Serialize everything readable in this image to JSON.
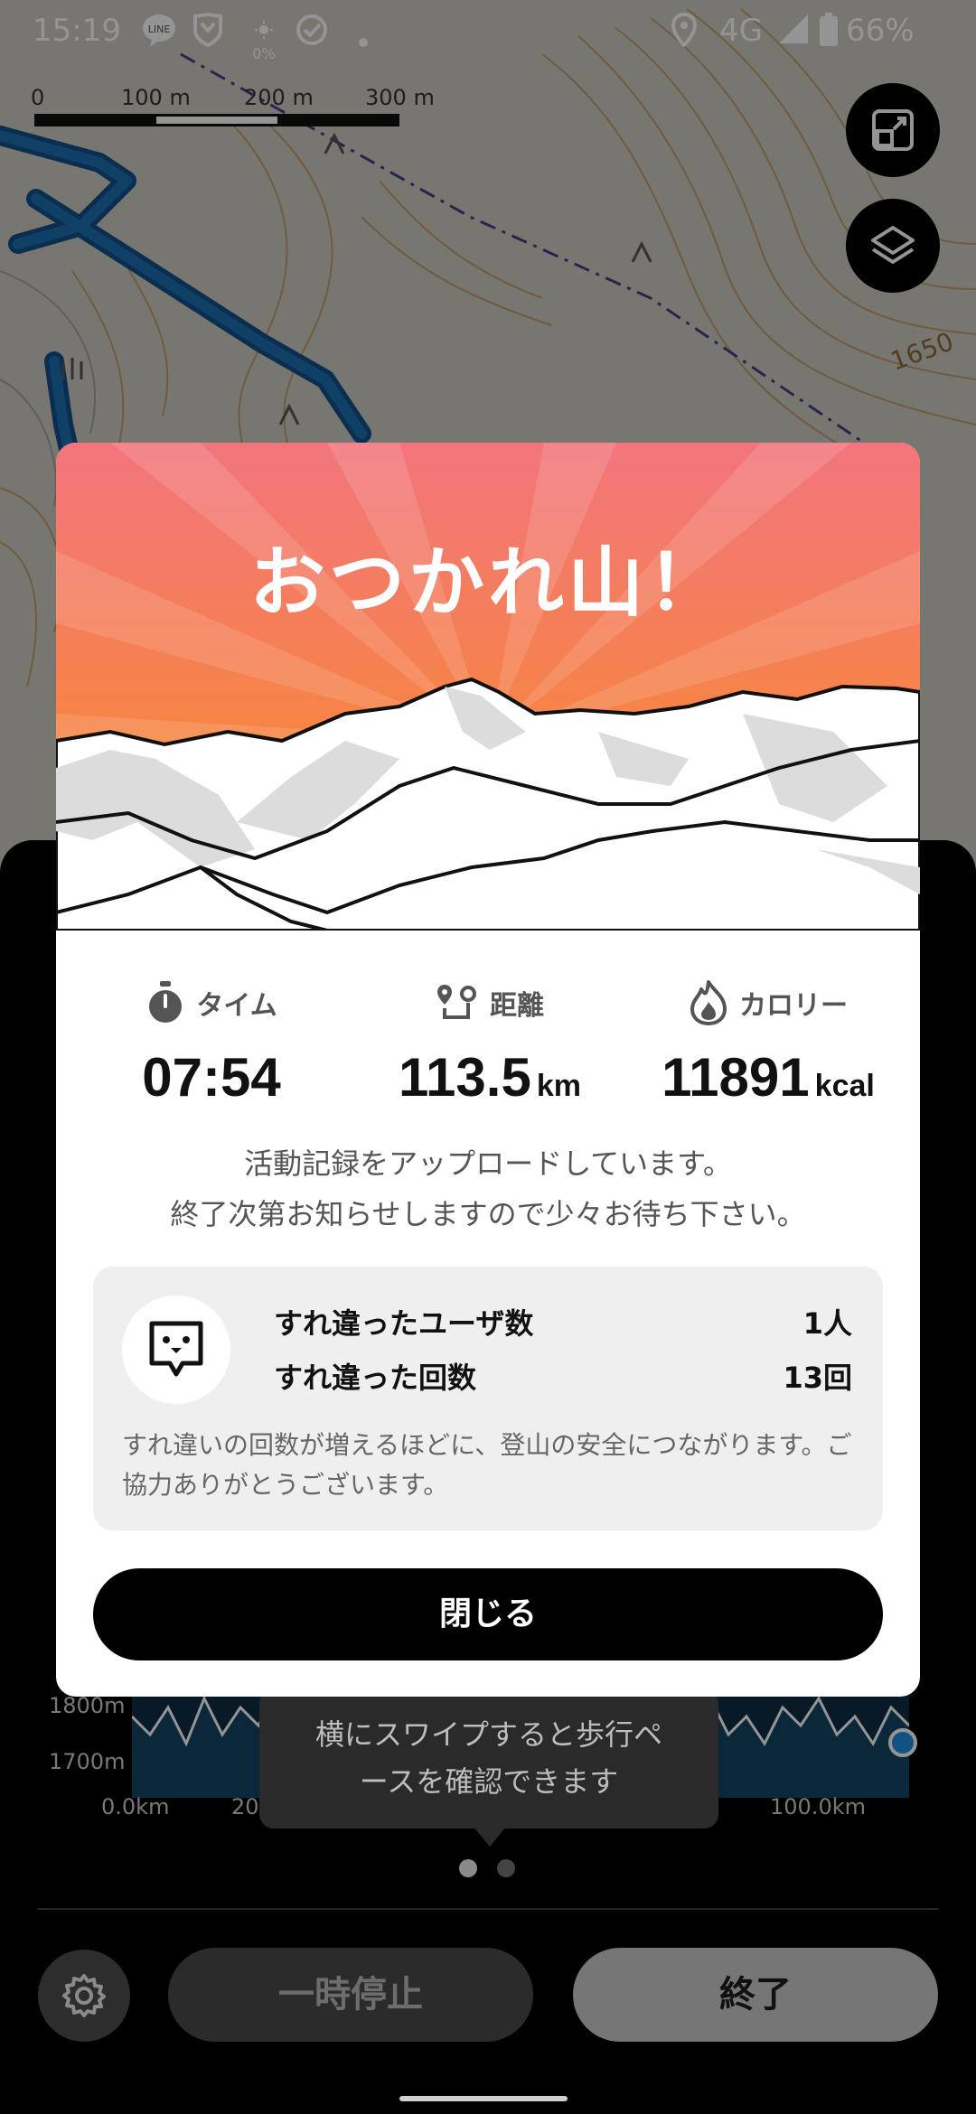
{
  "status_bar": {
    "time": "15:19",
    "brightness_text": "0%",
    "network": "4G",
    "battery": "66%"
  },
  "map": {
    "scale_labels": [
      "0",
      "100 m",
      "200 m",
      "300 m"
    ],
    "contour_label": "1650"
  },
  "dialog": {
    "title": "おつかれ山！",
    "stats": [
      {
        "icon": "stopwatch-icon",
        "label": "タイム",
        "value": "07:54",
        "unit": ""
      },
      {
        "icon": "route-icon",
        "label": "距離",
        "value": "113.5",
        "unit": "km"
      },
      {
        "icon": "flame-icon",
        "label": "カロリー",
        "value": "11891",
        "unit": "kcal"
      }
    ],
    "upload_message_line1": "活動記録をアップロードしています。",
    "upload_message_line2": "終了次第お知らせしますので少々お待ち下さい。",
    "encounter": {
      "users_label": "すれ違ったユーザ数",
      "users_value": "1人",
      "count_label": "すれ違った回数",
      "count_value": "13回",
      "note": "すれ違いの回数が増えるほどに、登山の安全につながります。ご協力ありがとうございます。"
    },
    "close_label": "閉じる"
  },
  "background_panel": {
    "chart_y_labels": [
      "1800m",
      "1700m"
    ],
    "chart_x_labels": [
      "0.0km",
      "20",
      "100.0km"
    ]
  },
  "tooltip": {
    "line1": "横にスワイプすると歩行ペ",
    "line2": "ースを確認できます"
  },
  "pager": {
    "count": 2,
    "active": 0
  },
  "controls": {
    "pause_label": "一時停止",
    "end_label": "終了"
  },
  "colors": {
    "hero_top": "#f2757d",
    "hero_bottom": "#f7873a",
    "route_blue": "#1e6fb0",
    "dialog_bg": "#ffffff",
    "accent_blue": "#1c8fe0"
  }
}
